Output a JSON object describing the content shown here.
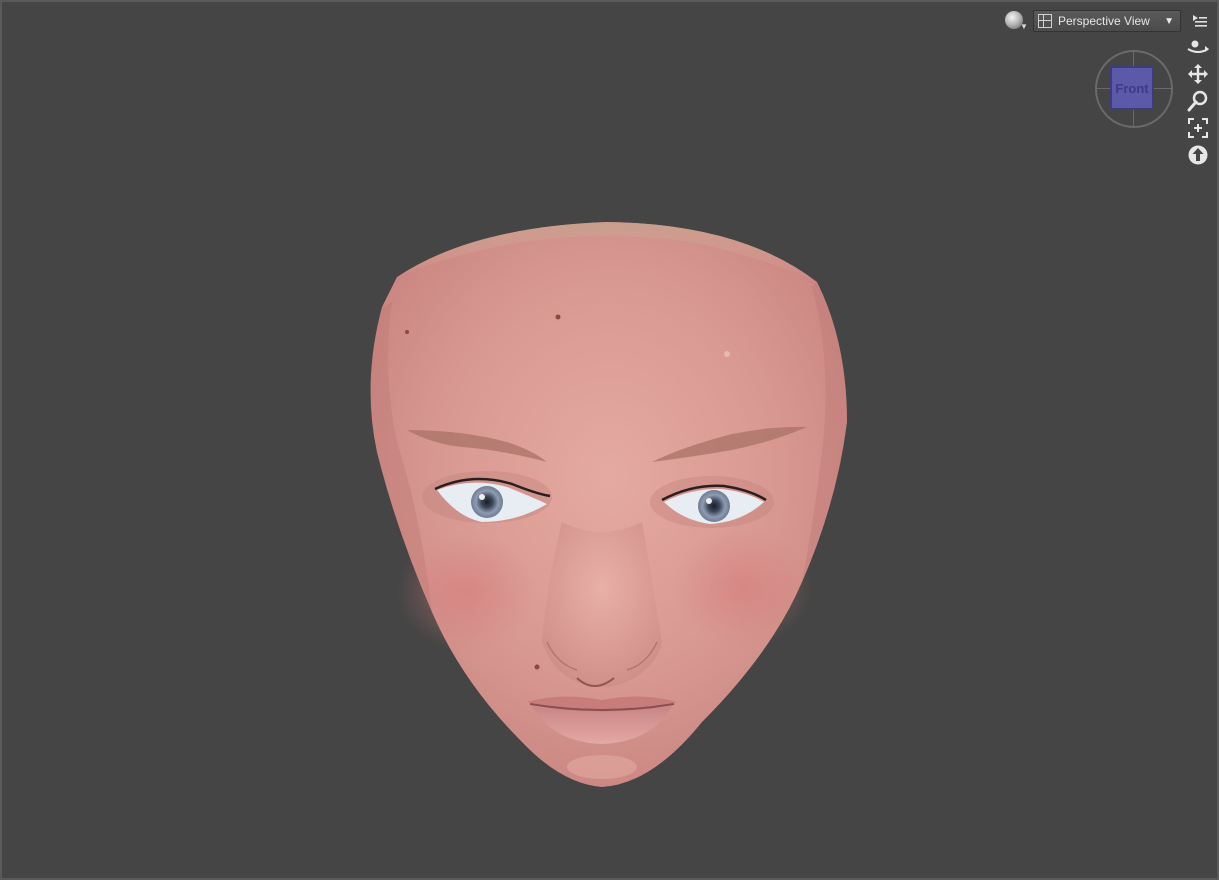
{
  "viewport": {
    "background_color": "#454545",
    "view_selector": {
      "label": "Perspective View",
      "icon": "viewport-layout-icon"
    },
    "shading_button": {
      "icon": "shading-sphere-icon"
    },
    "menu_button": {
      "icon": "viewport-menu-icon"
    },
    "nav_cube": {
      "face_label": "Front",
      "face_color": "#5c5aa8"
    },
    "tools": [
      {
        "name": "orbit",
        "icon": "orbit-icon"
      },
      {
        "name": "pan",
        "icon": "pan-move-icon"
      },
      {
        "name": "zoom",
        "icon": "zoom-magnifier-icon"
      },
      {
        "name": "frame",
        "icon": "frame-selection-icon"
      },
      {
        "name": "reset",
        "icon": "reset-view-icon"
      }
    ],
    "model": {
      "subject": "3D face mesh",
      "skin_color": "#d99a92"
    }
  }
}
